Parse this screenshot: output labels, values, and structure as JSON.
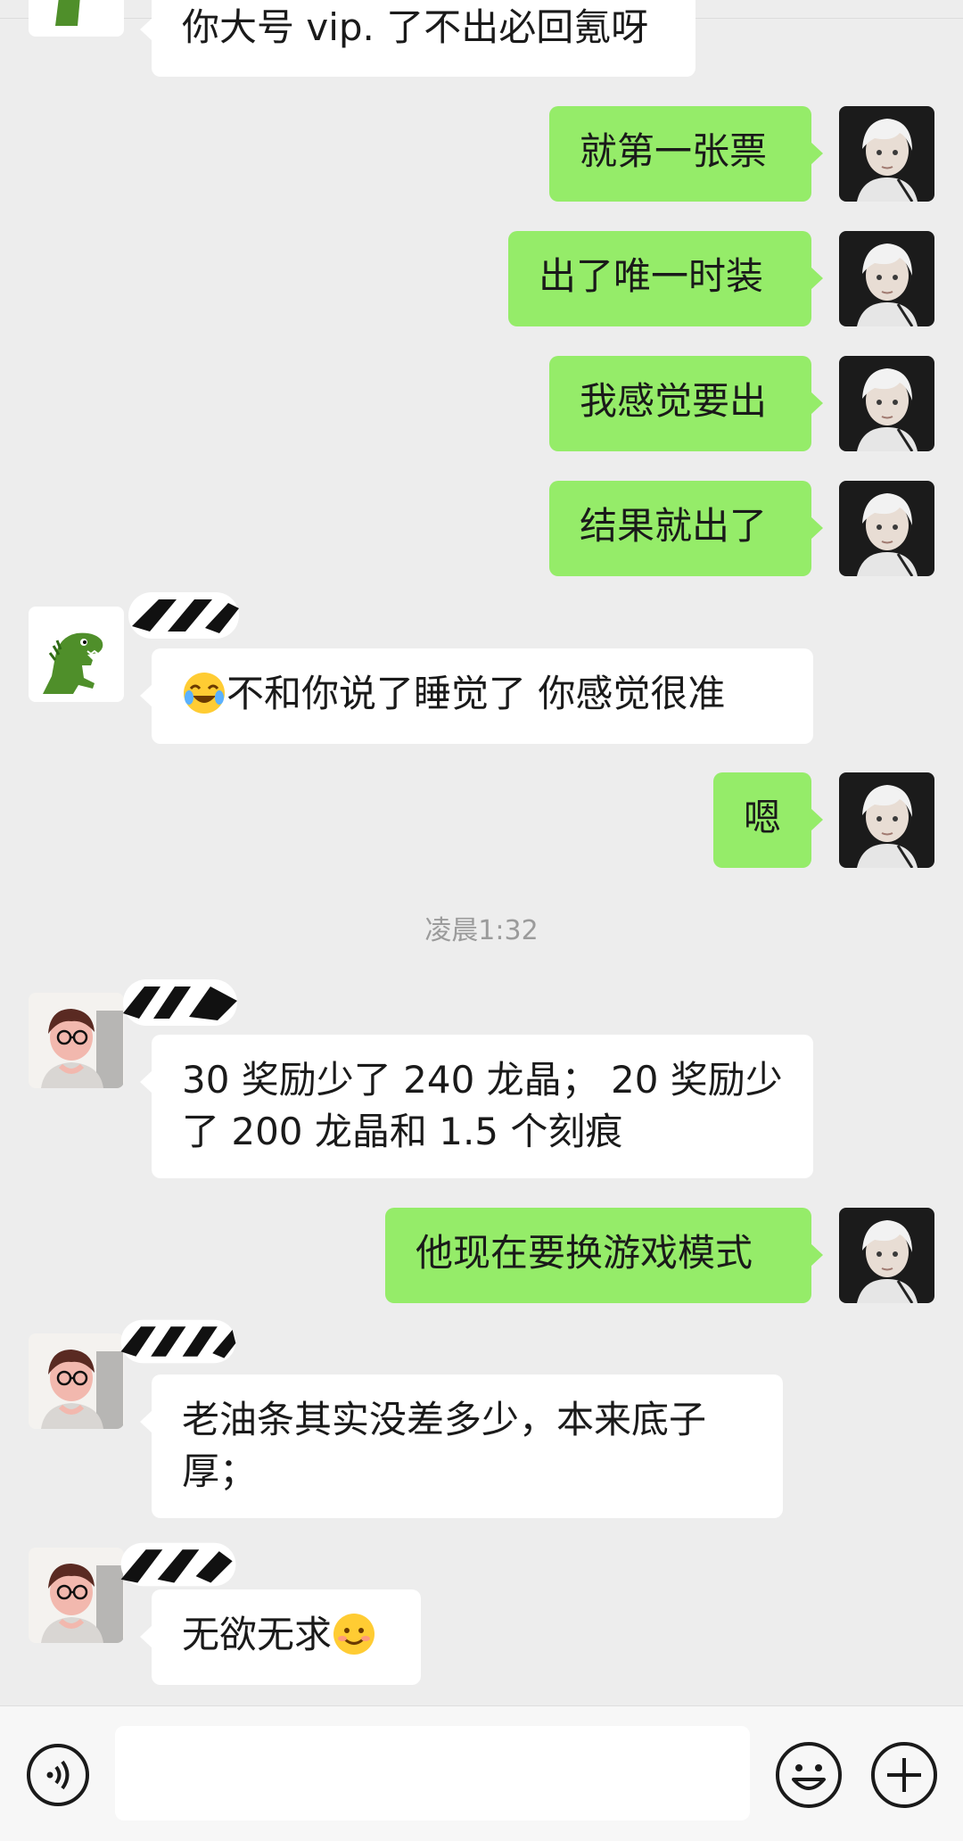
{
  "conversation": {
    "partial_top_message": "你大号 vip. 了不出必回氪呀",
    "messages": [
      {
        "side": "out",
        "text": "就第一张票"
      },
      {
        "side": "out",
        "text": "出了唯一时装"
      },
      {
        "side": "out",
        "text": "我感觉要出"
      },
      {
        "side": "out",
        "text": "结果就出了"
      },
      {
        "side": "in",
        "text": "不和你说了睡觉了 你感觉很准",
        "emoji": "crying-laughing-emoji"
      },
      {
        "side": "out",
        "text": "嗯"
      },
      {
        "side": "in",
        "text": "30 奖励少了 240 龙晶； 20 奖励少了 200 龙晶和 1.5 个刻痕"
      },
      {
        "side": "out",
        "text": "他现在要换游戏模式"
      },
      {
        "side": "in",
        "text": "老油条其实没差多少，本来底子厚；"
      },
      {
        "side": "in",
        "text": "无欲无求",
        "emoji": "smiling-face-emoji"
      }
    ],
    "timestamp": "凌晨1:32"
  },
  "input_bar": {
    "placeholder": "",
    "icons": [
      "voice-icon",
      "emoji-face-icon",
      "plus-icon"
    ]
  },
  "colors": {
    "background": "#ededed",
    "outgoing_bubble": "#95ec69",
    "incoming_bubble": "#ffffff"
  }
}
